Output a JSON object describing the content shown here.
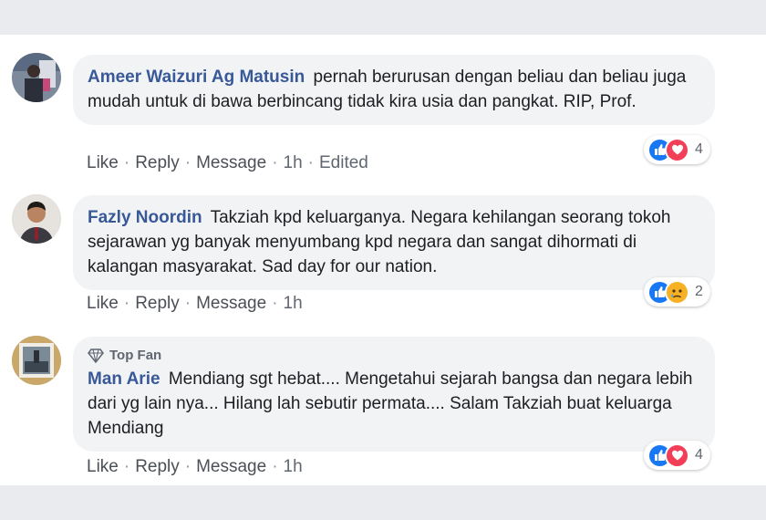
{
  "comments": [
    {
      "author": "Ameer Waizuri Ag Matusin",
      "text": "pernah berurusan dengan beliau dan beliau juga mudah untuk di bawa berbincang tidak kira usia dan pangkat. RIP, Prof.",
      "actions": {
        "like": "Like",
        "reply": "Reply",
        "message": "Message",
        "time": "1h",
        "edited": "Edited"
      },
      "reaction_count": "4",
      "reactions": [
        "like-icon",
        "love-icon"
      ]
    },
    {
      "author": "Fazly Noordin",
      "text": "Takziah kpd keluarganya. Negara kehilangan seorang tokoh sejarawan yg banyak menyumbang kpd negara dan sangat dihormati di kalangan masyarakat. Sad day for our nation.",
      "actions": {
        "like": "Like",
        "reply": "Reply",
        "message": "Message",
        "time": "1h"
      },
      "reaction_count": "2",
      "reactions": [
        "like-icon",
        "sad-icon"
      ]
    },
    {
      "badge": "Top Fan",
      "author": "Man Arie",
      "text": "Mendiang sgt hebat.... Mengetahui sejarah bangsa dan negara lebih dari yg lain nya... Hilang lah sebutir permata.... Salam Takziah buat keluarga Mendiang",
      "actions": {
        "like": "Like",
        "reply": "Reply",
        "message": "Message",
        "time": "1h"
      },
      "reaction_count": "4",
      "reactions": [
        "like-icon",
        "love-icon"
      ]
    }
  ],
  "separator": "·",
  "colors": {
    "author": "#385898",
    "bubble": "#f2f3f5",
    "like": "#1877f2",
    "love": "#f33e58",
    "sad": "#f7b125"
  }
}
